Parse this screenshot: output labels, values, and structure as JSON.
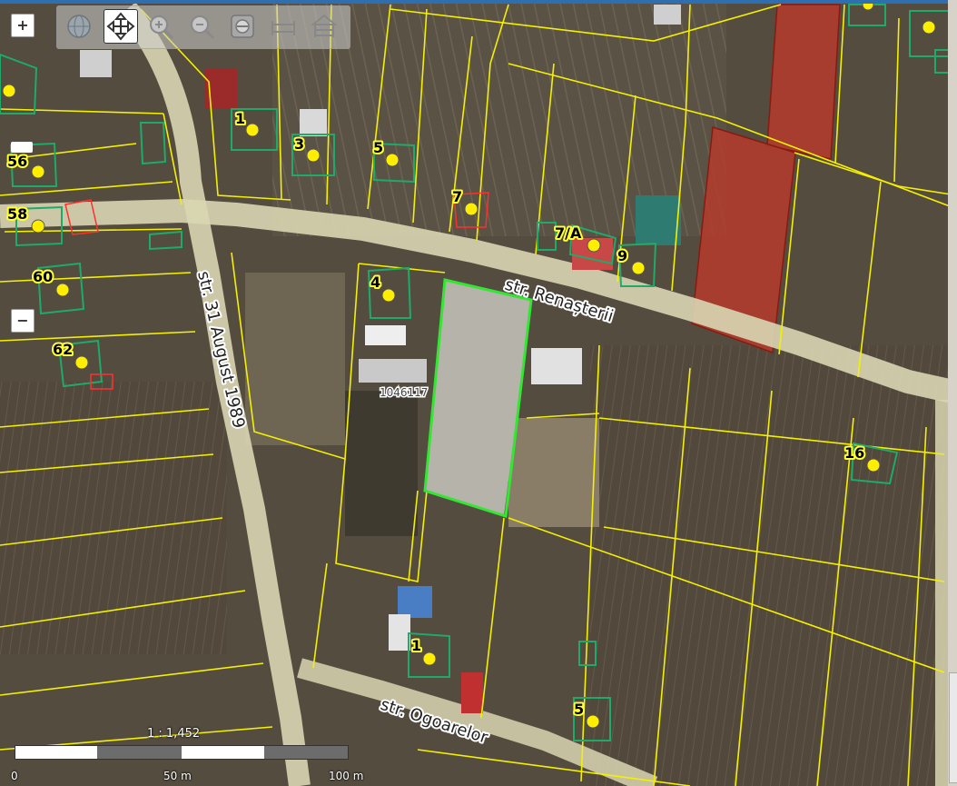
{
  "toolbar": {
    "tools": [
      "globe-tool",
      "pan-tool",
      "zoom-in-tool",
      "zoom-out-tool",
      "full-extent-tool",
      "measure-tool",
      "measure-area-tool"
    ],
    "active_tool": "pan-tool"
  },
  "zoom": {
    "in_label": "+",
    "out_label": "−"
  },
  "streets": {
    "s1": "str. 31 August 1989",
    "s2": "str. Renașterii",
    "s3": "str. Ogoarelor"
  },
  "house_numbers": {
    "h1": "1",
    "h2": "3",
    "h3": "5",
    "h4": "7",
    "h5": "7/A",
    "h6": "9",
    "h7": "4",
    "h8": "56",
    "h9": "58",
    "h10": "60",
    "h11": "62",
    "h12": "16",
    "h13": "1",
    "h14": "5"
  },
  "parcel_id": "1046117",
  "scale": {
    "ratio": "1 : 1,452",
    "label_0": "0",
    "label_50": "50 m",
    "label_100": "100 m"
  },
  "colors": {
    "parcel_line": "#f5f000",
    "building_outline": "#1faa6a",
    "selected_parcel": "#33e633",
    "highlight_parcel": "#b83a2c",
    "point_marker": "#ffee00"
  }
}
